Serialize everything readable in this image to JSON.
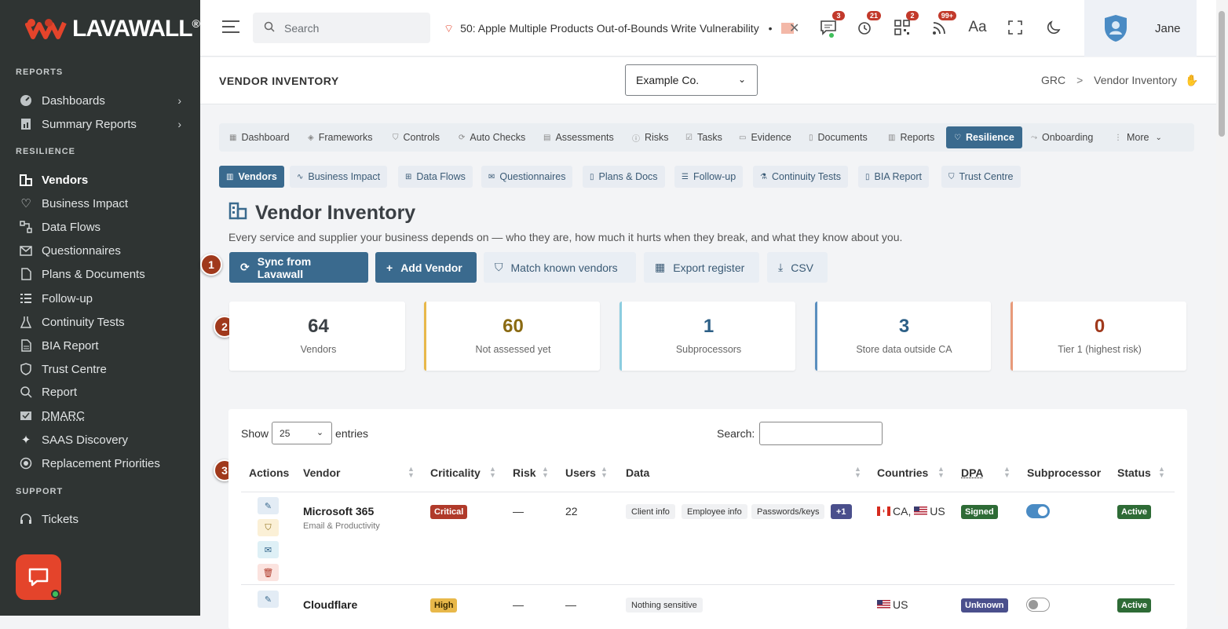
{
  "brand": {
    "name_lava": "LAVA",
    "name_wall": "WALL",
    "reg": "®",
    "accent": "#e4442b"
  },
  "sidebar": {
    "sections": [
      "REPORTS",
      "RESILIENCE",
      "SUPPORT"
    ],
    "items": [
      {
        "label": "Dashboards",
        "icon": "dashboard-icon"
      },
      {
        "label": "Summary Reports",
        "icon": "report-icon"
      },
      {
        "label": "Vendors",
        "icon": "building-icon"
      },
      {
        "label": "Business Impact",
        "icon": "heart-icon"
      },
      {
        "label": "Data Flows",
        "icon": "flow-icon"
      },
      {
        "label": "Questionnaires",
        "icon": "envelope-icon"
      },
      {
        "label": "Plans & Documents",
        "icon": "document-icon"
      },
      {
        "label": "Follow-up",
        "icon": "list-icon"
      },
      {
        "label": "Continuity Tests",
        "icon": "flask-icon"
      },
      {
        "label": "BIA Report",
        "icon": "file-icon"
      },
      {
        "label": "Trust Centre",
        "icon": "shield-icon"
      },
      {
        "label": "Report",
        "icon": "search-report-icon"
      },
      {
        "label": "DMARC",
        "icon": "mail-check-icon"
      },
      {
        "label": "SAAS Discovery",
        "icon": "sparkle-icon"
      },
      {
        "label": "Replacement Priorities",
        "icon": "circle-icon"
      },
      {
        "label": "Tickets",
        "icon": "headset-icon"
      }
    ]
  },
  "topbar": {
    "search_placeholder": "Search",
    "ticker": "50: Apple Multiple Products Out-of-Bounds Write Vulnerability",
    "ticker_sep": "•",
    "badges": {
      "messages": "3",
      "alerts": "21",
      "qr": "2",
      "feeds": "99+"
    },
    "user": "Jane"
  },
  "header": {
    "title": "VENDOR INVENTORY",
    "company": "Example Co.",
    "crumb_root": "GRC",
    "crumb_sep": ">",
    "crumb_current": "Vendor Inventory"
  },
  "module_tabs": [
    "Dashboard",
    "Frameworks",
    "Controls",
    "Auto Checks",
    "Assessments",
    "Risks",
    "Tasks",
    "Evidence",
    "Documents",
    "Reports",
    "Resilience",
    "Onboarding",
    "More"
  ],
  "sub_tabs": [
    "Vendors",
    "Business Impact",
    "Data Flows",
    "Questionnaires",
    "Plans & Docs",
    "Follow-up",
    "Continuity Tests",
    "BIA Report",
    "Trust Centre"
  ],
  "main": {
    "title": "Vendor Inventory",
    "description": "Every service and supplier your business depends on — who they are, how much it hurts when they break, and what they know about you.",
    "buttons": {
      "sync": "Sync from Lavawall",
      "add": "Add Vendor",
      "match": "Match known vendors",
      "export": "Export register",
      "csv": "CSV"
    },
    "markers": [
      "1",
      "2",
      "3"
    ]
  },
  "stats": [
    {
      "value": "64",
      "label": "Vendors",
      "color": "#3a3f44",
      "border": "#ffffff"
    },
    {
      "value": "60",
      "label": "Not assessed yet",
      "color": "#8a6a12",
      "border": "#e8b84a"
    },
    {
      "value": "1",
      "label": "Subprocessors",
      "color": "#2c5f86",
      "border": "#8ccde0"
    },
    {
      "value": "3",
      "label": "Store data outside CA",
      "color": "#2c5f86",
      "border": "#5a8fbf"
    },
    {
      "value": "0",
      "label": "Tier 1 (highest risk)",
      "color": "#a0391c",
      "border": "#e89a7a"
    }
  ],
  "table": {
    "show_label": "Show",
    "page_size": "25",
    "entries_label": "entries",
    "search_label": "Search:",
    "columns": [
      "Actions",
      "Vendor",
      "Criticality",
      "Risk",
      "Users",
      "Data",
      "Countries",
      "DPA",
      "Subprocessor",
      "Status"
    ],
    "rows": [
      {
        "vendor": "Microsoft 365",
        "category": "Email & Productivity",
        "criticality": "Critical",
        "crit_color": "#b03a2a",
        "risk": "—",
        "users": "22",
        "data": [
          "Client info",
          "Employee info",
          "Passwords/keys",
          "+1"
        ],
        "countries": [
          "CA,",
          "US"
        ],
        "dpa": "Signed",
        "dpa_color": "#2e6b36",
        "subprocessor": true,
        "status": "Active"
      },
      {
        "vendor": "Cloudflare",
        "category": "",
        "criticality": "High",
        "crit_color": "#e8b84a",
        "risk": "—",
        "users": "—",
        "data": [
          "Nothing sensitive"
        ],
        "countries": [
          "US"
        ],
        "dpa": "Unknown",
        "dpa_color": "#4a4f8c",
        "subprocessor": false,
        "status": "Active"
      }
    ]
  }
}
